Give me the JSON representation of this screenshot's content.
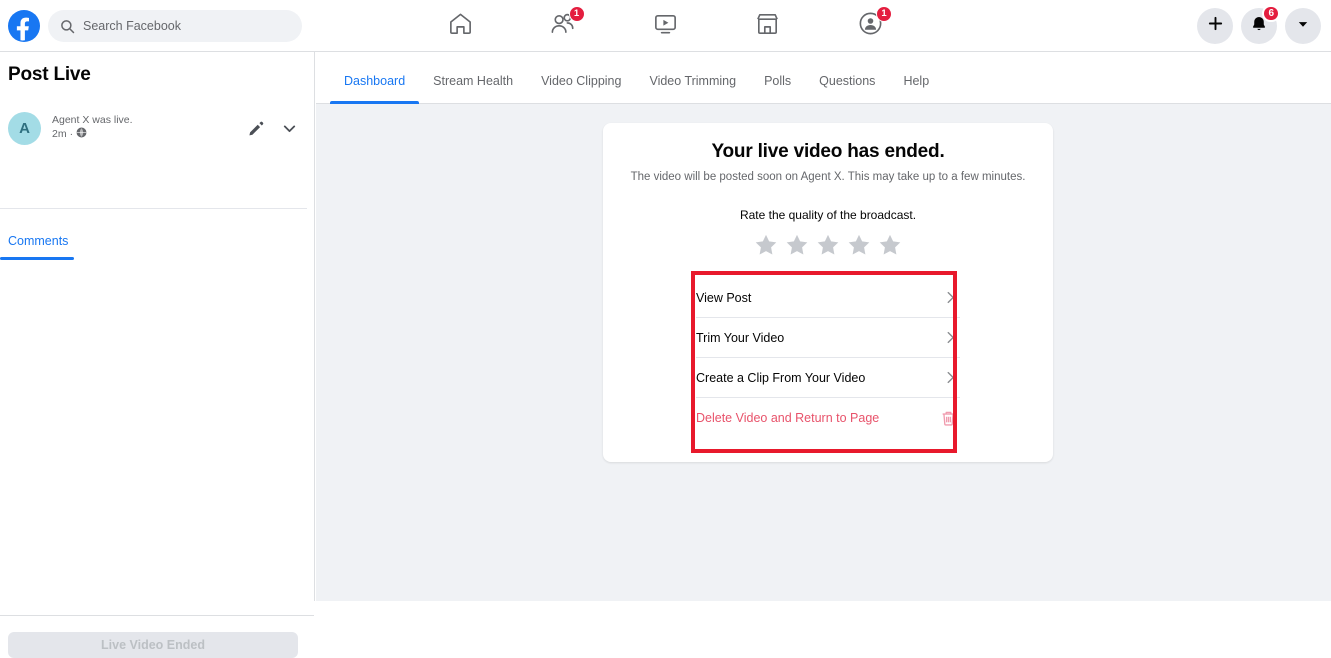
{
  "topbar": {
    "logo_icon": "facebook-logo-icon",
    "search": {
      "icon": "search-icon",
      "placeholder": "Search Facebook",
      "value": ""
    },
    "nav_items": [
      {
        "icon": "home-icon",
        "name": "home",
        "badge": ""
      },
      {
        "icon": "friends-icon",
        "name": "friends",
        "badge": "1"
      },
      {
        "icon": "watch-video-icon",
        "name": "watch",
        "badge": ""
      },
      {
        "icon": "marketplace-icon",
        "name": "marketplace",
        "badge": ""
      },
      {
        "icon": "groups-icon",
        "name": "groups",
        "badge": "1"
      }
    ],
    "right_buttons": [
      {
        "icon": "plus-icon",
        "name": "create",
        "badge": ""
      },
      {
        "icon": "bell-icon",
        "name": "notifications",
        "badge": "6"
      },
      {
        "icon": "chevron-down-icon",
        "name": "account",
        "badge": ""
      }
    ]
  },
  "sidebar": {
    "title": "Post Live",
    "post": {
      "avatar_initial": "A",
      "avatar_bg": "#a3dce6",
      "avatar_fg": "#2e6f7f",
      "author_line": "Agent X was live.",
      "timestamp": "2m",
      "separator": "·",
      "privacy_icon": "globe-icon",
      "edit_icon": "pencil-icon",
      "expand_icon": "chevron-down-icon"
    },
    "tabs": [
      {
        "label": "Comments",
        "active": true
      }
    ],
    "footer_button": {
      "label": "Live Video Ended",
      "disabled": true
    }
  },
  "main": {
    "tabs": [
      {
        "label": "Dashboard",
        "active": true
      },
      {
        "label": "Stream Health",
        "active": false
      },
      {
        "label": "Video Clipping",
        "active": false
      },
      {
        "label": "Video Trimming",
        "active": false
      },
      {
        "label": "Polls",
        "active": false
      },
      {
        "label": "Questions",
        "active": false
      },
      {
        "label": "Help",
        "active": false
      }
    ],
    "card": {
      "title": "Your live video has ended.",
      "subtitle": "The video will be posted soon on Agent X. This may take up to a few minutes.",
      "rate_label": "Rate the quality of the broadcast.",
      "rating": {
        "icon": "star-icon",
        "total": 5,
        "selected": 0,
        "color": "#c6c9ce"
      },
      "actions": [
        {
          "label": "View Post",
          "icon": "chevron-right-icon",
          "danger": false
        },
        {
          "label": "Trim Your Video",
          "icon": "chevron-right-icon",
          "danger": false
        },
        {
          "label": "Create a Clip From Your Video",
          "icon": "chevron-right-icon",
          "danger": false
        },
        {
          "label": "Delete Video and Return to Page",
          "icon": "trash-icon",
          "danger": true
        }
      ]
    }
  },
  "annotation": {
    "name": "red-highlight-box",
    "color": "#e8192c"
  },
  "colors": {
    "brand_blue": "#1877f2",
    "page_bg": "#f0f2f5",
    "card_bg": "#ffffff",
    "badge_red": "#e41e3f",
    "danger_red": "#e8536b",
    "text_primary": "#050505",
    "text_secondary": "#65676b"
  }
}
